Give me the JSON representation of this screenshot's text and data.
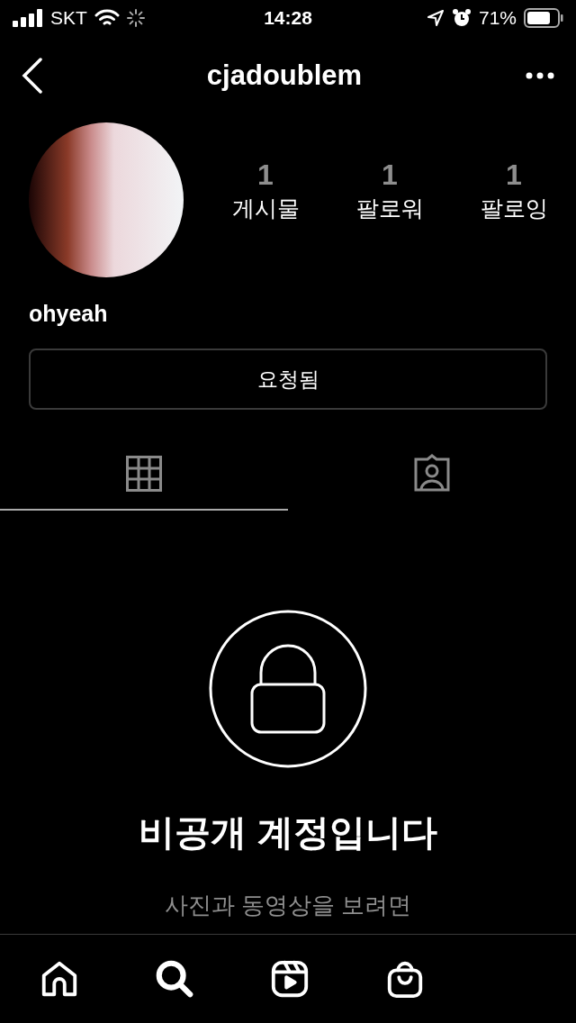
{
  "status_bar": {
    "carrier": "SKT",
    "time": "14:28",
    "battery": "71%"
  },
  "nav": {
    "title": "cjadoublem"
  },
  "profile": {
    "stats": [
      {
        "count": "1",
        "label": "게시물"
      },
      {
        "count": "1",
        "label": "팔로워"
      },
      {
        "count": "1",
        "label": "팔로잉"
      }
    ],
    "name": "ohyeah",
    "button": "요청됨"
  },
  "tabs": [
    {
      "kind": "grid",
      "selected": true
    },
    {
      "kind": "tagged",
      "selected": false
    }
  ],
  "private": {
    "title": "비공개 계정입니다",
    "message": "사진과 동영상을 보려면"
  },
  "bottom_nav": [
    {
      "kind": "home"
    },
    {
      "kind": "search"
    },
    {
      "kind": "reels"
    },
    {
      "kind": "shop"
    }
  ]
}
